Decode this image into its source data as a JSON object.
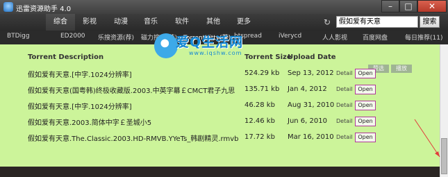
{
  "window": {
    "title": "迅雷资源助手 4.0",
    "controls": {
      "minimize": "–",
      "maximize": "□",
      "close": "✕"
    }
  },
  "categories": [
    "综合",
    "影视",
    "动漫",
    "音乐",
    "软件",
    "其他",
    "更多"
  ],
  "active_category": "综合",
  "search": {
    "value": "假如爱有天意",
    "button": "搜索",
    "refresh_icon": "refresh-icon"
  },
  "sites": [
    {
      "label": "BTDigg"
    },
    {
      "label": "ED2000"
    },
    {
      "label": "乐搜资源(荐)"
    },
    {
      "label": "磁力搜索(荐)"
    },
    {
      "label": "TorrentKitty(荐)"
    },
    {
      "label": "btspread"
    },
    {
      "label": "iVerycd"
    },
    {
      "label": "人人影视"
    },
    {
      "label": "百度网盘"
    },
    {
      "label": "每日推荐(11)"
    }
  ],
  "table": {
    "headers": {
      "description": "Torrent Description",
      "size": "Torrent Size",
      "date": "Upload Date"
    },
    "toolbar": {
      "a": "赞选",
      "b": "播放"
    },
    "rows": [
      {
        "desc": "假如爱有天意.[中字.1024分辨率]",
        "size": "524.29 kb",
        "date": "Sep 13, 2012",
        "detail": "Detail",
        "open": "Open"
      },
      {
        "desc": "假如爱有天意(国粤韩)终极收藏版.2003.中英字幕￡CMCT君子九思",
        "size": "135.71 kb",
        "date": "Jan 4, 2012",
        "detail": "Detail",
        "open": "Open"
      },
      {
        "desc": "假如爱有天意.[中字.1024分辨率]",
        "size": "46.28 kb",
        "date": "Aug 31, 2010",
        "detail": "Detail",
        "open": "Open"
      },
      {
        "desc": "假如爱有天意.2003.简体中字￡圣城小5",
        "size": "12.46 kb",
        "date": "Jun 6, 2010",
        "detail": "Detail",
        "open": "Open"
      },
      {
        "desc": "假如爱有天意.The.Classic.2003.HD-RMVB.YYeTs_韩剧精灵.rmvb",
        "size": "17.72 kb",
        "date": "Mar 16, 2010",
        "detail": "Detail",
        "open": "Open"
      }
    ]
  },
  "watermark": {
    "text": "爱Q生活网",
    "sub": "www.iqshw.com"
  },
  "colors": {
    "content_bg": "#ccf49a",
    "open_border": "#b0379b",
    "accent_red": "#e23a3a"
  }
}
